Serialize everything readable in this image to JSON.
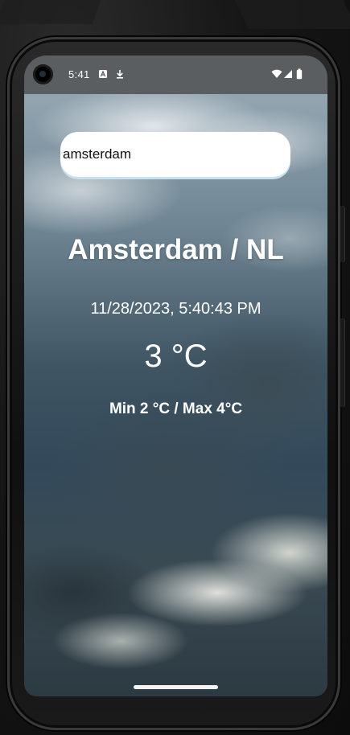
{
  "status_bar": {
    "time": "5:41",
    "left_icons": [
      "text-notification-icon",
      "download-icon"
    ],
    "right_icons": [
      "wifi-icon",
      "cellular-signal-icon",
      "battery-icon"
    ]
  },
  "search": {
    "value": "amsterdam",
    "placeholder": ""
  },
  "weather": {
    "location": "Amsterdam / NL",
    "datetime": "11/28/2023, 5:40:43 PM",
    "temperature": "3 °C",
    "min_max": "Min 2 °C / Max 4°C"
  },
  "colors": {
    "status_bar_bg": "#5b5e60",
    "text": "#ffffff",
    "search_bg": "#ffffff",
    "search_underline": "#c7e2ee"
  }
}
